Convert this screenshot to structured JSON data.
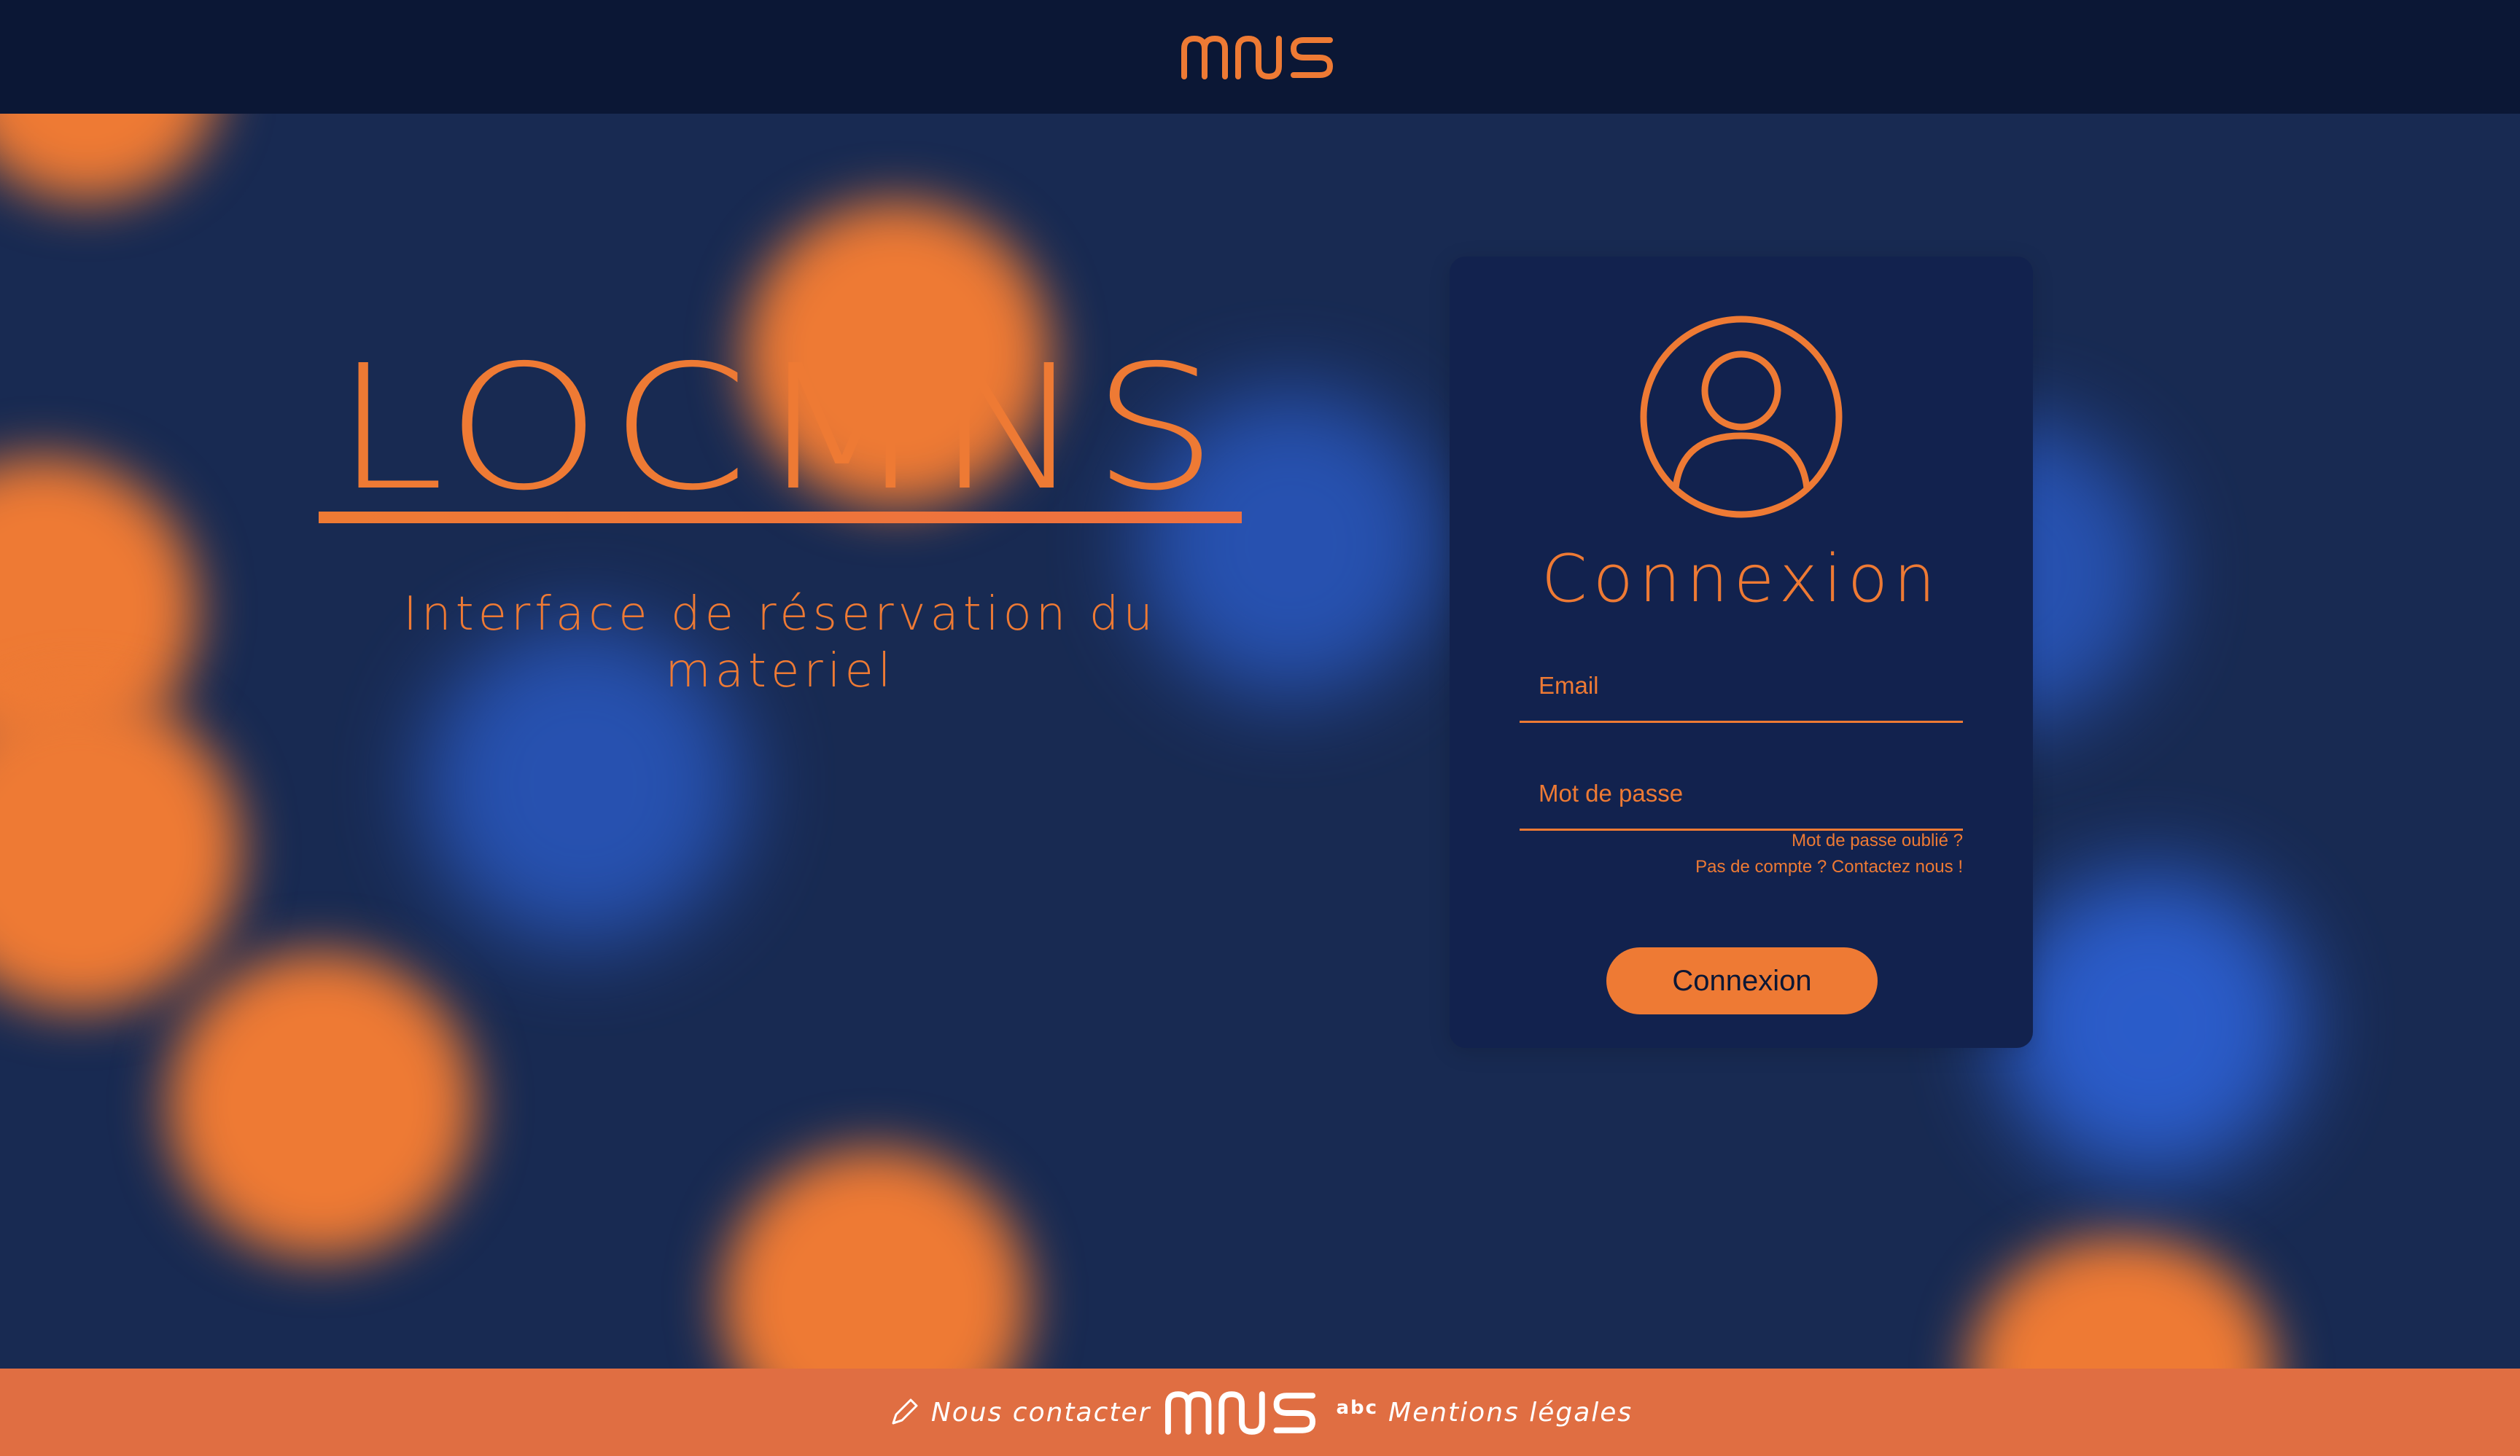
{
  "header": {
    "logo_text": "MNS"
  },
  "hero": {
    "title": "LOCMNS",
    "tagline_line1": "Interface de réservation du",
    "tagline_line2": "materiel"
  },
  "login": {
    "title": "Connexion",
    "email_placeholder": "Email",
    "password_placeholder": "Mot de passe",
    "forgot_link": "Mot de passe oublié ?",
    "no_account_link": "Pas de compte ? Contactez nous !",
    "submit_label": "Connexion"
  },
  "footer": {
    "contact_label": "Nous contacter",
    "logo_text": "MNS",
    "abc_icon_text": "abc",
    "legal_label": "Mentions légales"
  },
  "colors": {
    "accent": "#ee7a34",
    "header_bg": "#0b1735",
    "page_bg": "#182a52",
    "card_bg": "#12224e",
    "footer_bg": "#e06e42"
  }
}
